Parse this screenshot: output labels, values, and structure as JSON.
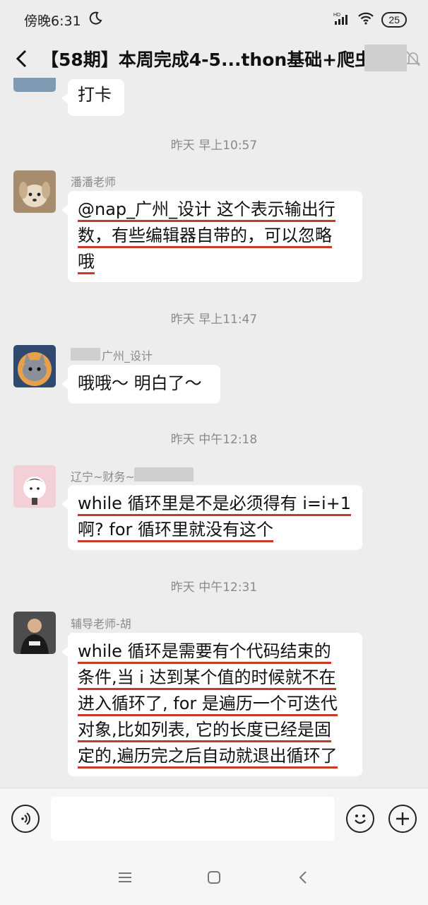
{
  "status": {
    "time": "傍晚6:31",
    "battery": "25",
    "network": "HD"
  },
  "header": {
    "title": "【58期】本周完成4-5...thon基础+爬虫"
  },
  "chat": {
    "top_message": "打卡",
    "messages": [
      {
        "timestamp": "昨天 早上10:57",
        "sender": "潘潘老师",
        "lines": [
          "@nap_广州_设计  这个表示输出行",
          "数，有些编辑器自带的，可以忽略",
          "哦"
        ]
      },
      {
        "timestamp": "昨天 早上11:47",
        "sender": "广州_设计",
        "lines": [
          "哦哦～  明白了～"
        ]
      },
      {
        "timestamp": "昨天 中午12:18",
        "sender": "辽宁~财务~",
        "lines": [
          "while 循环里是不是必须得有 i=i+1",
          "啊? for 循环里就没有这个"
        ]
      },
      {
        "timestamp": "昨天 中午12:31",
        "sender": "辅导老师-胡",
        "lines": [
          "while 循环是需要有个代码结束的",
          "条件,当 i 达到某个值的时候就不在",
          "进入循环了, for 是遍历一个可迭代",
          "对象,比如列表, 它的长度已经是固",
          "定的,遍历完之后自动就退出循环了"
        ]
      }
    ]
  },
  "input": {
    "value": "",
    "placeholder": ""
  },
  "icons": {
    "back": "back-arrow-icon",
    "mute": "mute-bell-icon",
    "voice": "voice-icon",
    "emoji": "emoji-icon",
    "add": "plus-icon",
    "moon": "moon-icon",
    "wifi": "wifi-icon",
    "signal": "signal-icon",
    "menu": "menu-icon",
    "home": "home-icon",
    "nav_back": "nav-back-icon"
  }
}
